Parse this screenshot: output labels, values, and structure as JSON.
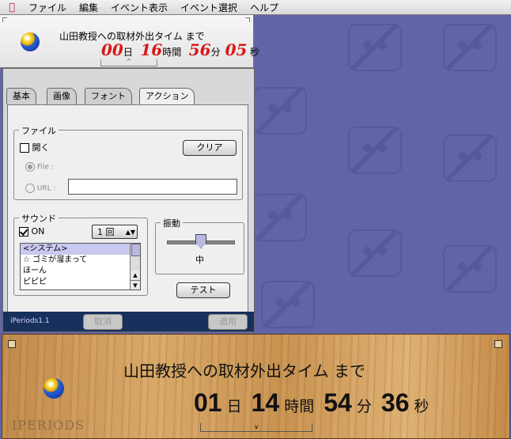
{
  "menubar": {
    "apple_icon": "apple-logo-icon",
    "items": [
      "ファイル",
      "編集",
      "イベント表示",
      "イベント選択",
      "ヘルプ"
    ]
  },
  "top_timer": {
    "title": "山田教授への取材外出タイム まで",
    "days": "00",
    "days_unit": "日",
    "hours": "16",
    "hours_unit": "時間",
    "minutes": "56",
    "minutes_unit": "分",
    "seconds": "05",
    "seconds_unit": "秒",
    "handle_glyph": "^",
    "digit_color": "#d81818"
  },
  "settings": {
    "tabs": [
      "基本",
      "画像",
      "フォント",
      "アクション"
    ],
    "active_tab": "アクション",
    "file_group": {
      "title": "ファイル",
      "open_label": "開く",
      "open_checked": false,
      "clear_button": "クリア",
      "file_radio": "File :",
      "url_radio": "URL :",
      "url_value": ""
    },
    "sound_group": {
      "title": "サウンド",
      "on_label": "ON",
      "on_checked": true,
      "repeat_value": "1 回",
      "options": [
        "<システム>",
        "☆ ゴミが溜まって",
        "ほーん",
        "ピピピ"
      ],
      "selected_index": 0
    },
    "vibration_group": {
      "title": "振動",
      "level_label": "中",
      "level_fraction": 0.5
    },
    "test_button": "テスト",
    "footer": {
      "version": "iPeriods1.1",
      "cancel_button": "取消",
      "apply_button": "適用",
      "background": "#17305c"
    }
  },
  "wood_timer": {
    "title": "山田教授への取材外出タイム まで",
    "days": "01",
    "days_unit": "日",
    "hours": "14",
    "hours_unit": "時間",
    "minutes": "54",
    "minutes_unit": "分",
    "seconds": "36",
    "seconds_unit": "秒",
    "logo": "IPERIODS",
    "handle_glyph": "v"
  },
  "colors": {
    "desktop": "#6264a8",
    "panel": "#d8d8d8"
  }
}
